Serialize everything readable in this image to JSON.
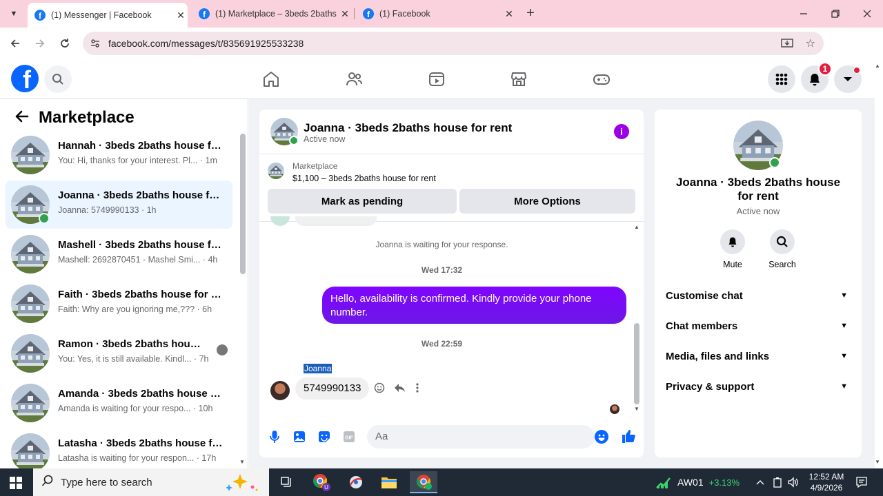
{
  "browser": {
    "tabs": [
      {
        "title": "(1) Messenger | Facebook"
      },
      {
        "title": "(1) Marketplace – 3beds 2baths"
      },
      {
        "title": "(1) Facebook"
      }
    ],
    "url": "facebook.com/messages/t/835691925533238"
  },
  "fbnav": {
    "notif_count": "1"
  },
  "sidebar": {
    "title": "Marketplace",
    "conversations": [
      {
        "name": "Hannah · 3beds 2baths house for rent",
        "preview": "You: Hi, thanks for your interest. Pl... · 1m"
      },
      {
        "name": "Joanna · 3beds 2baths house for rent",
        "preview": "Joanna: 5749990133 · 1h"
      },
      {
        "name": "Mashell · 3beds 2baths house for rent",
        "preview": "Mashell: 2692870451 - Mashel Smi... · 4h"
      },
      {
        "name": "Faith · 3beds 2baths house for rent",
        "preview": "Faith: Why are you ignoring me,??? · 6h"
      },
      {
        "name": "Ramon · 3beds 2baths house for rent",
        "preview": "You: Yes, it is still available. Kindl... · 7h"
      },
      {
        "name": "Amanda · 3beds 2baths house for rent",
        "preview": "Amanda is waiting for your respo... · 10h"
      },
      {
        "name": "Latasha · 3beds 2baths house for rent",
        "preview": "Latasha is waiting for your respon... · 17h"
      }
    ]
  },
  "chat": {
    "name": "Joanna · 3beds 2baths house for rent",
    "status": "Active now",
    "marketplace_label": "Marketplace",
    "listing": "$1,100 – 3beds 2baths house for rent",
    "btn_pending": "Mark as pending",
    "btn_more": "More Options",
    "waiting": "Joanna is waiting for your response.",
    "time1": "Wed 17:32",
    "out_msg": "Hello, availability is confirmed. Kindly provide your phone number.",
    "time2": "Wed 22:59",
    "sender": "Joanna",
    "in_msg": "5749990133",
    "composer_placeholder": "Aa"
  },
  "rpanel": {
    "name": "Joanna · 3beds 2baths house for rent",
    "status": "Active now",
    "mute": "Mute",
    "search": "Search",
    "sections": [
      "Customise chat",
      "Chat members",
      "Media, files and links",
      "Privacy & support"
    ]
  },
  "taskbar": {
    "search_placeholder": "Type here to search",
    "stock_name": "AW01",
    "stock_change": "+3.13%",
    "time": "12:52 AM",
    "date": "4/9/2026"
  },
  "colors": {
    "fb_blue": "#0866ff",
    "messenger_purple": "#7c00ff",
    "online_green": "#31a24c",
    "badge_red": "#e41e3f",
    "tab_bar_pink": "#f9d2dd"
  }
}
